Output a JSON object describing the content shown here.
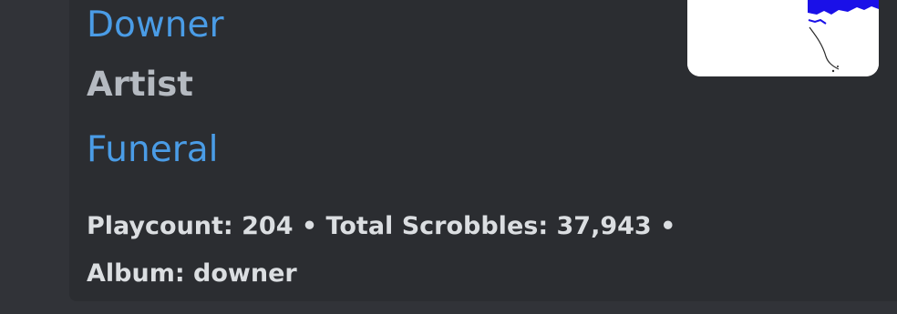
{
  "embed": {
    "track_link": "Downer",
    "field_name": "Artist",
    "artist_link": "Funeral",
    "footer": "Playcount: 204 • Total Scrobbles: 37,943 • Album: downer"
  },
  "thumbnail": {
    "accent_color": "#1a10e8",
    "background_color": "#ffffff"
  }
}
